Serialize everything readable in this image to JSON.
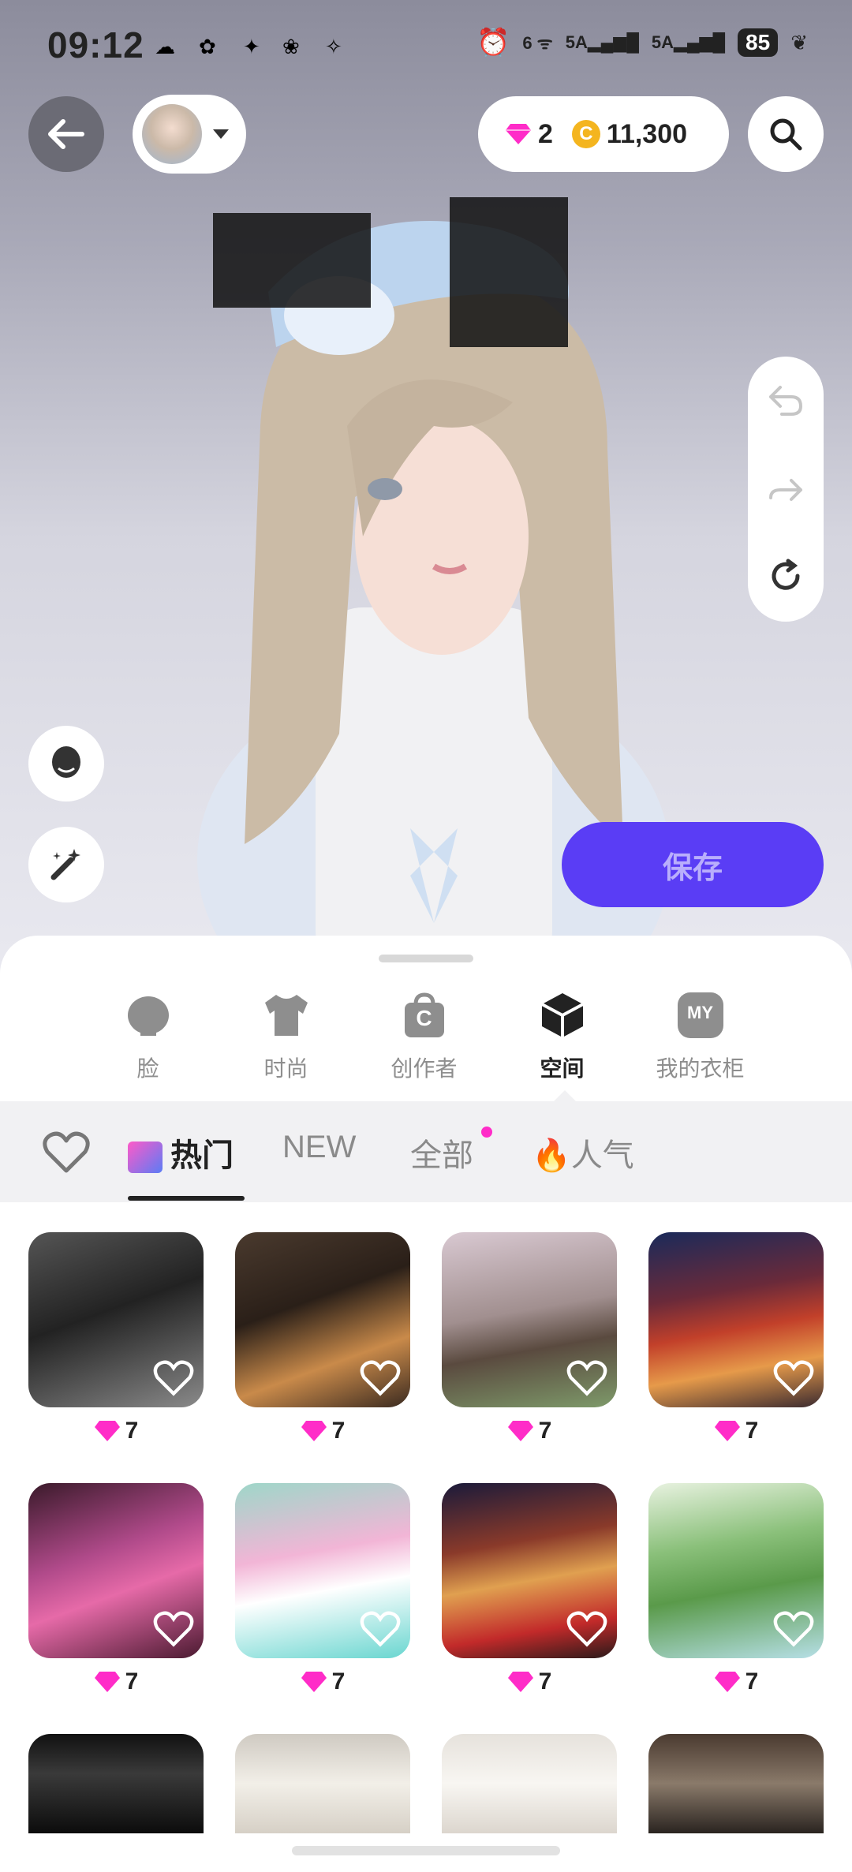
{
  "status_bar": {
    "time": "09:12",
    "network_labels": [
      "6",
      "5A",
      "5A"
    ],
    "battery": "85"
  },
  "header": {
    "gems": "2",
    "coin_symbol": "C",
    "coins": "11,300"
  },
  "actions": {
    "save_label": "保存"
  },
  "categories": [
    {
      "label": "脸",
      "icon": "face-icon"
    },
    {
      "label": "时尚",
      "icon": "shirt-icon"
    },
    {
      "label": "创作者",
      "icon": "creator-bag-icon",
      "glyph": "C"
    },
    {
      "label": "空间",
      "icon": "cube-icon",
      "active": true
    },
    {
      "label": "我的衣柜",
      "icon": "my-wardrobe-icon",
      "glyph": "MY"
    }
  ],
  "tabs": {
    "hot": "热门",
    "new": "NEW",
    "all": "全部",
    "popular": "人气"
  },
  "items": [
    {
      "price": "7",
      "scene": "dark street"
    },
    {
      "price": "7",
      "scene": "cozy lounge"
    },
    {
      "price": "7",
      "scene": "cherry blossom tree"
    },
    {
      "price": "7",
      "scene": "lantern street festival"
    },
    {
      "price": "7",
      "scene": "pink neon room"
    },
    {
      "price": "7",
      "scene": "pastel panda house"
    },
    {
      "price": "7",
      "scene": "red bridge night market"
    },
    {
      "price": "7",
      "scene": "green garden fence"
    },
    {
      "price": "",
      "scene": "spotlight stage"
    },
    {
      "price": "",
      "scene": "bright curtain room"
    },
    {
      "price": "",
      "scene": "white bedroom"
    },
    {
      "price": "",
      "scene": "eiffel tower view"
    }
  ],
  "colors": {
    "accent": "#5a3df5",
    "gem": "#ff2cc8",
    "coin": "#f4b51f"
  }
}
